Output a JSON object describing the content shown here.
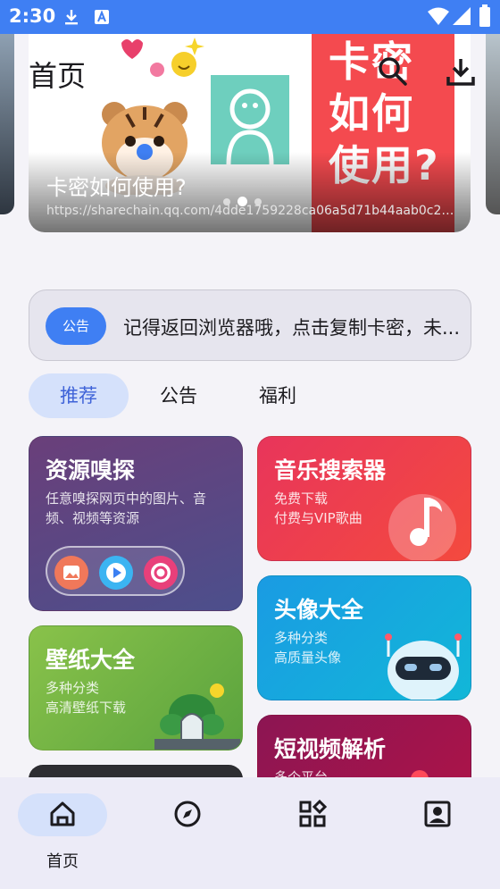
{
  "status_bar": {
    "time": "2:30",
    "icons": [
      "download-icon",
      "a-letter-icon",
      "wifi-icon",
      "signal-icon",
      "battery-icon"
    ]
  },
  "header": {
    "title": "首页",
    "actions": [
      "search-icon",
      "download-icon"
    ]
  },
  "banner": {
    "title": "卡密如何使用?",
    "url": "https://sharechain.qq.com/4dde1759228ca06a5d71b44aab0c28...",
    "poster_text": "卡密如何使用?",
    "dots": 3,
    "active_dot": 1
  },
  "notice": {
    "chip_label": "公告",
    "text": "记得返回浏览器哦，点击复制卡密，未..."
  },
  "tabs": [
    {
      "label": "推荐",
      "active": true
    },
    {
      "label": "公告",
      "active": false
    },
    {
      "label": "福利",
      "active": false
    }
  ],
  "cards": {
    "sniff": {
      "title": "资源嗅探",
      "sub1": "任意嗅探网页中的图片、音",
      "sub2": "频、视频等资源"
    },
    "music": {
      "title": "音乐搜索器",
      "sub1": "免费下载",
      "sub2": "付费与VIP歌曲"
    },
    "avatar": {
      "title": "头像大全",
      "sub1": "多种分类",
      "sub2": "高质量头像"
    },
    "wallpaper": {
      "title": "壁纸大全",
      "sub1": "多种分类",
      "sub2": "高清壁纸下载"
    },
    "video": {
      "title": "短视频解析",
      "sub1": "多个平台"
    }
  },
  "bottom_nav": [
    {
      "label": "首页",
      "icon": "home-icon",
      "active": true
    },
    {
      "label": "",
      "icon": "compass-icon",
      "active": false
    },
    {
      "label": "",
      "icon": "apps-icon",
      "active": false
    },
    {
      "label": "",
      "icon": "profile-icon",
      "active": false
    }
  ],
  "colors": {
    "accent": "#3f7ff3",
    "background": "#f4f3f8",
    "active_pill": "#d5e1fb"
  }
}
